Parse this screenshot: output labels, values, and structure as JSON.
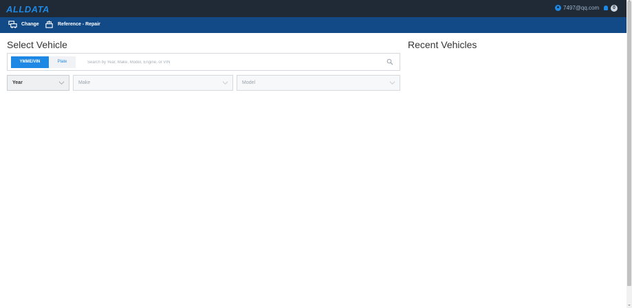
{
  "header": {
    "logo": "ALLDATA",
    "user_email": "7497@qq.com",
    "notification_count": "0"
  },
  "nav": {
    "change_label": "Change",
    "reference_label": "Reference - Repair"
  },
  "select_vehicle": {
    "title": "Select Vehicle",
    "tabs": [
      "YMME/VIN",
      "Plate"
    ],
    "active_tab": "YMME/VIN",
    "search_placeholder": "Search by Year, Make, Model, Engine, or VIN",
    "dropdowns": {
      "year": "Year",
      "make": "Make",
      "model": "Model"
    }
  },
  "recent": {
    "title": "Recent Vehicles"
  },
  "colors": {
    "topbar": "#1f2a36",
    "navbar": "#124a87",
    "accent": "#1e88e5"
  },
  "icons": {
    "user": "user-circle-icon",
    "bell": "bell-icon",
    "change": "vehicle-change-icon",
    "reference": "reference-repair-icon",
    "search": "search-icon",
    "chevron": "chevron-down-icon"
  }
}
